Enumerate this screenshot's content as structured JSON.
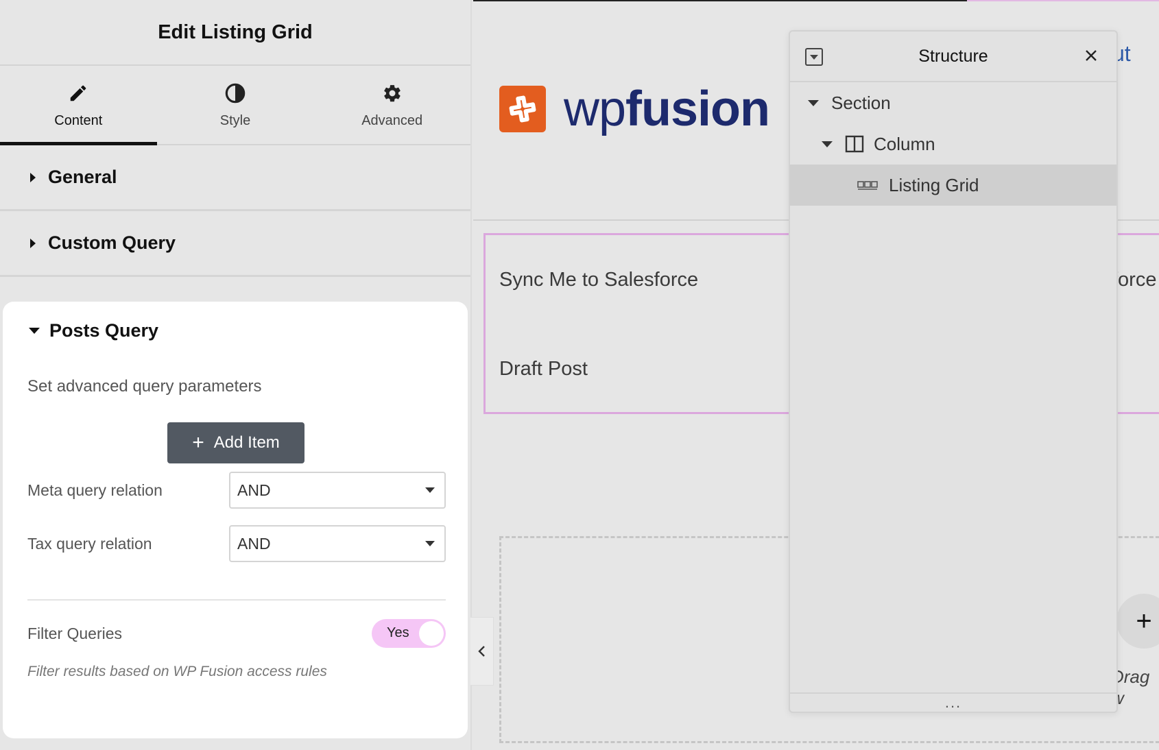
{
  "panel": {
    "title": "Edit Listing Grid",
    "tabs": [
      {
        "label": "Content",
        "icon": "pencil-icon",
        "active": true
      },
      {
        "label": "Style",
        "icon": "contrast-icon",
        "active": false
      },
      {
        "label": "Advanced",
        "icon": "gear-icon",
        "active": false
      }
    ],
    "sections": {
      "general": "General",
      "custom_query": "Custom Query",
      "posts_query": "Posts Query"
    },
    "posts_query": {
      "description": "Set advanced query parameters",
      "add_item_label": "Add Item",
      "meta_relation_label": "Meta query relation",
      "meta_relation_value": "AND",
      "tax_relation_label": "Tax query relation",
      "tax_relation_value": "AND",
      "filter_label": "Filter Queries",
      "filter_toggle": "Yes",
      "filter_help": "Filter results based on WP Fusion access rules"
    }
  },
  "canvas": {
    "logo_wp": "wp",
    "logo_fusion": "fusion",
    "header_link_fragment": "ut",
    "posts": [
      "Sync Me to Salesforce",
      "Draft Post"
    ],
    "posts_right_fragment": "force",
    "drag_text_fragment": "Drag w",
    "colors": {
      "logo_orange": "#e35d1f",
      "logo_navy": "#1d2a6d",
      "selection_pink": "#dba7dd"
    }
  },
  "navigator": {
    "title": "Structure",
    "items": [
      {
        "label": "Section",
        "icon": "caret-down-icon"
      },
      {
        "label": "Column",
        "icon": "column-icon"
      },
      {
        "label": "Listing Grid",
        "icon": "listing-grid-icon",
        "selected": true
      }
    ],
    "footer": "..."
  }
}
